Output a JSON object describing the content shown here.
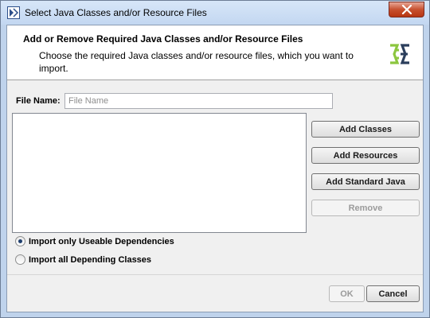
{
  "window": {
    "title": "Select Java Classes and/or Resource Files"
  },
  "header": {
    "title": "Add or Remove Required Java Classes and/or Resource Files",
    "description": "Choose the required Java classes and/or resource files, which you want to import."
  },
  "file_name": {
    "label": "File Name:",
    "placeholder": "File Name",
    "value": ""
  },
  "actions": {
    "add_classes": "Add Classes",
    "add_resources": "Add Resources",
    "add_standard_java": "Add Standard Java",
    "remove": "Remove"
  },
  "import_options": [
    {
      "label": "Import only Useable Dependencies",
      "selected": true
    },
    {
      "label": "Import all Depending Classes",
      "selected": false
    }
  ],
  "footer": {
    "ok": "OK",
    "cancel": "Cancel"
  },
  "colors": {
    "accent": "#1f3f6e",
    "logo_green": "#8cc63f",
    "logo_navy": "#2b3e5c",
    "close_red": "#c7502f"
  },
  "icons": {
    "app": "magicdraw-app-icon",
    "logo": "java-import-logo-icon",
    "close": "close-icon"
  }
}
